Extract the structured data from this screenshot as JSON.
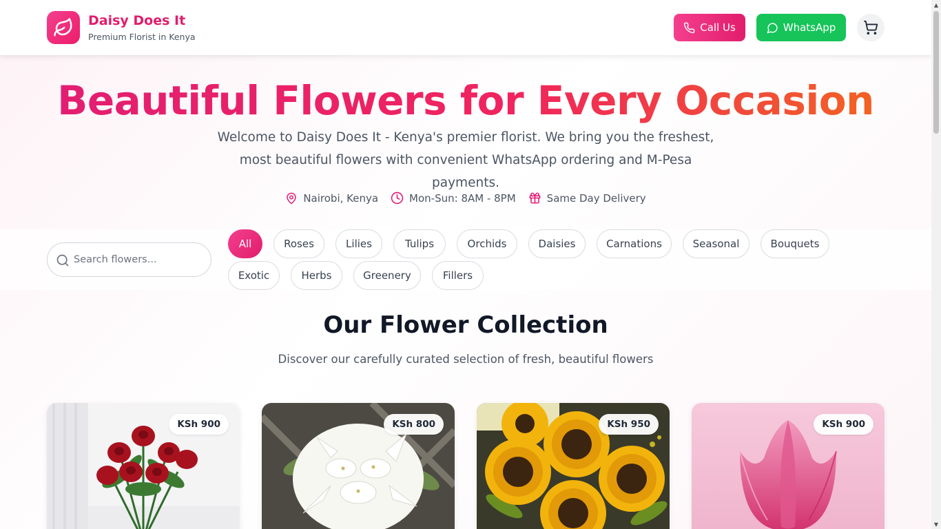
{
  "brand": {
    "name": "Daisy Does It",
    "tagline": "Premium Florist in Kenya"
  },
  "header": {
    "call_label": "Call Us",
    "whatsapp_label": "WhatsApp"
  },
  "hero": {
    "title": "Beautiful Flowers for Every Occasion",
    "description": "Welcome to Daisy Does It - Kenya's premier florist. We bring you the freshest, most beautiful flowers with convenient WhatsApp ordering and M-Pesa payments.",
    "info": [
      {
        "icon": "map-pin-icon",
        "text": "Nairobi, Kenya"
      },
      {
        "icon": "clock-icon",
        "text": "Mon-Sun: 8AM - 8PM"
      },
      {
        "icon": "gift-icon",
        "text": "Same Day Delivery"
      }
    ]
  },
  "search": {
    "placeholder": "Search flowers..."
  },
  "categories": [
    "All",
    "Roses",
    "Lilies",
    "Tulips",
    "Orchids",
    "Daisies",
    "Carnations",
    "Seasonal",
    "Bouquets",
    "Exotic",
    "Herbs",
    "Greenery",
    "Fillers"
  ],
  "active_category": "All",
  "collection": {
    "title": "Our Flower Collection",
    "subtitle": "Discover our carefully curated selection of fresh, beautiful flowers"
  },
  "products": [
    {
      "price": "KSh 900",
      "image": "red-roses"
    },
    {
      "price": "KSh 800",
      "image": "white-lilies"
    },
    {
      "price": "KSh 950",
      "image": "sunflowers"
    },
    {
      "price": "KSh 900",
      "image": "pink-tulip"
    }
  ],
  "colors": {
    "brand_pink": "#e11d6b",
    "whatsapp_green": "#16c45a",
    "title_gradient_start": "#e11d74",
    "title_gradient_end": "#f26b1a"
  }
}
